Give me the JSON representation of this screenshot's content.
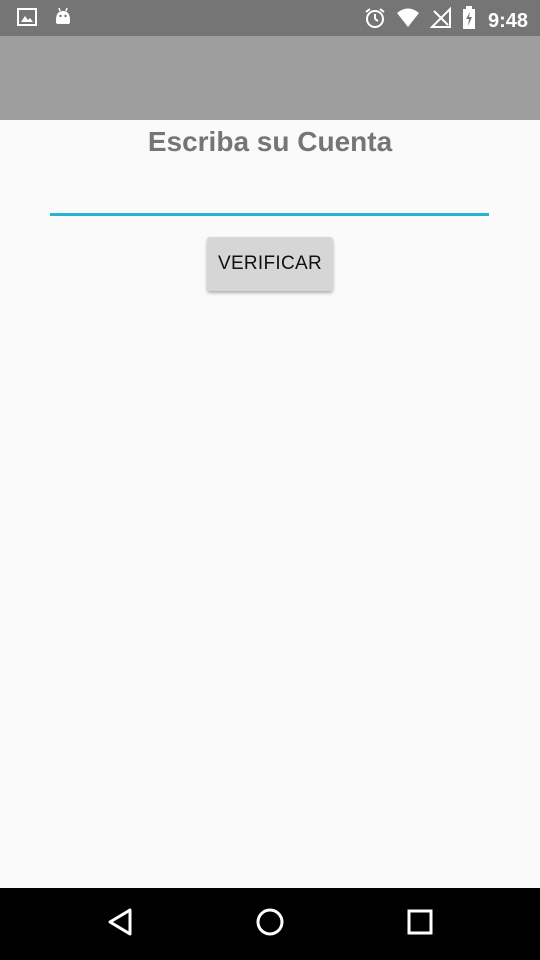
{
  "status_bar": {
    "time": "9:48",
    "left_icons": [
      "image-icon",
      "android-icon"
    ],
    "right_icons": [
      "alarm-icon",
      "wifi-icon",
      "no-signal-icon",
      "battery-icon"
    ]
  },
  "main": {
    "title": "Escriba su Cuenta",
    "account_input": {
      "value": "",
      "placeholder": ""
    },
    "verify_button_label": "VERIFICAR"
  },
  "nav_bar": {
    "buttons": [
      "back-icon",
      "home-icon",
      "recents-icon"
    ]
  },
  "colors": {
    "status_bar": "#757575",
    "app_bar": "#9e9e9e",
    "background": "#fafafa",
    "input_underline": "#26b5d0",
    "button": "#d6d6d6",
    "nav_bar": "#000000"
  }
}
